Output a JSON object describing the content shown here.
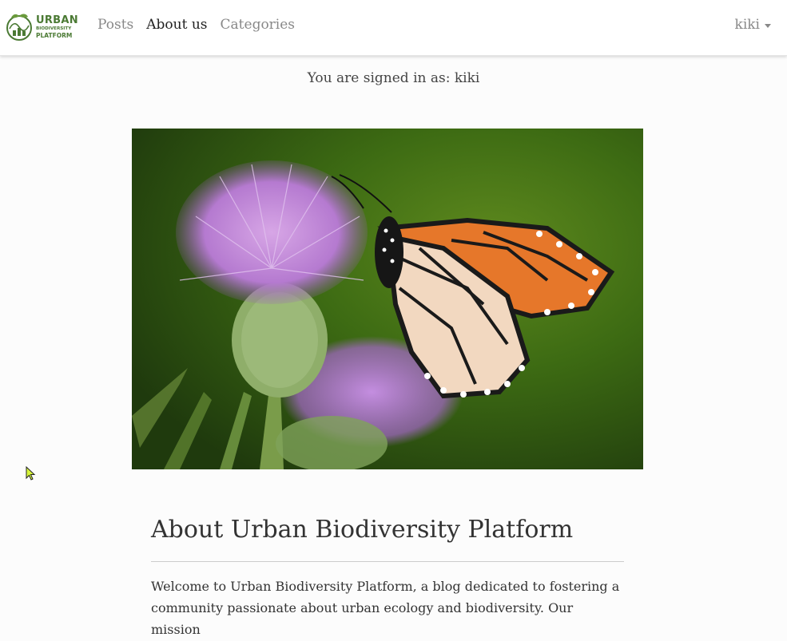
{
  "navbar": {
    "logo": {
      "line1": "URBAN",
      "line2": "BIODIVERSITY",
      "line3": "PLATFORM",
      "color": "#4b7a34"
    },
    "links": [
      {
        "label": "Posts",
        "active": false
      },
      {
        "label": "About us",
        "active": true
      },
      {
        "label": "Categories",
        "active": false
      }
    ],
    "user": {
      "label": "kiki"
    }
  },
  "status": {
    "signed_in_text": "You are signed in as: kiki"
  },
  "hero": {
    "subject": "monarch butterfly on purple thistle flower"
  },
  "article": {
    "title": "About Urban Biodiversity Platform",
    "intro": "Welcome to Urban Biodiversity Platform, a blog dedicated to fostering a community passionate about urban ecology and biodiversity. Our mission"
  },
  "colors": {
    "background": "#fcfcfc",
    "nav_text": "#888888",
    "nav_active": "#222222"
  }
}
